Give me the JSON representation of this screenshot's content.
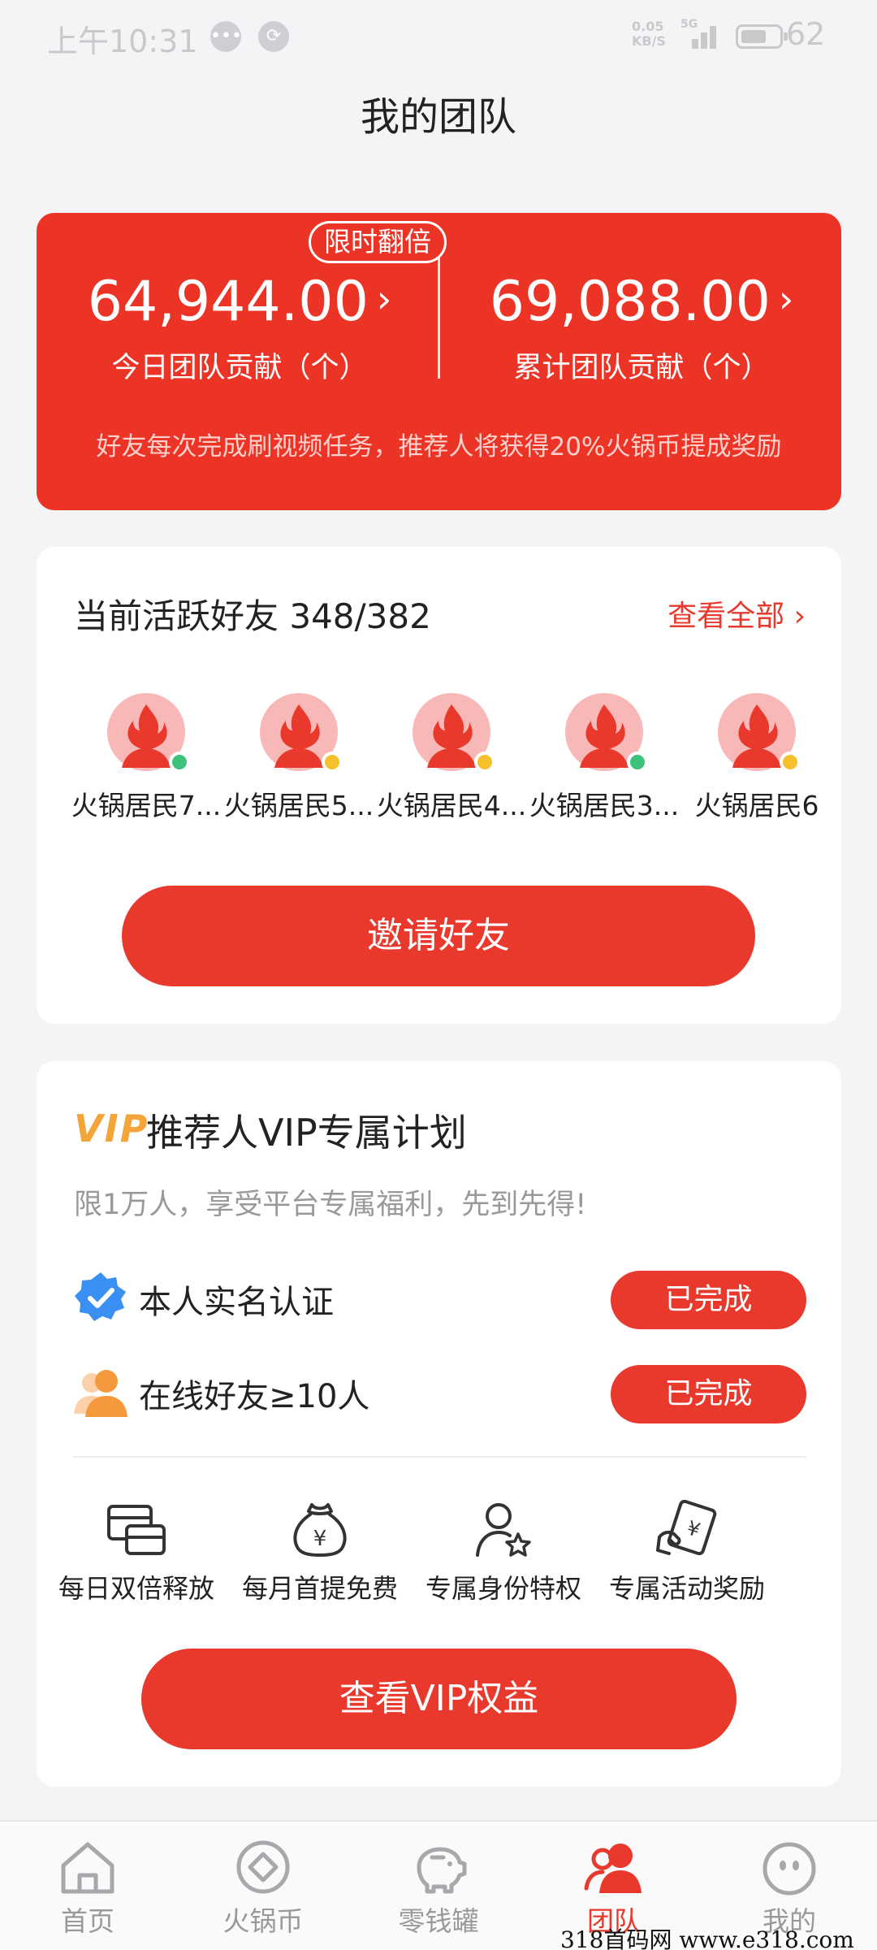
{
  "status_bar": {
    "time": "上午10:31",
    "speed_top": "0.05",
    "speed_bottom": "KB/S",
    "signal": "5G",
    "battery": "62"
  },
  "header": {
    "title": "我的团队"
  },
  "team_stats": {
    "badge": "限时翻倍",
    "today_value": "64,944.00",
    "today_label": "今日团队贡献（个）",
    "total_value": "69,088.00",
    "total_label": "累计团队贡献（个）",
    "note": "好友每次完成刷视频任务，推荐人将获得20%火锅币提成奖励",
    "chevron": "›"
  },
  "active_friends": {
    "title": "当前活跃好友 348/382",
    "view_all": "查看全部 ›",
    "friends": [
      {
        "name": "火锅居民7...",
        "status_color": "#3cc27a"
      },
      {
        "name": "火锅居民5...",
        "status_color": "#f5c02c"
      },
      {
        "name": "火锅居民4...",
        "status_color": "#f5c02c"
      },
      {
        "name": "火锅居民3...",
        "status_color": "#3cc27a"
      },
      {
        "name": "火锅居民6",
        "status_color": "#f5c02c"
      }
    ],
    "invite_button": "邀请好友"
  },
  "vip_plan": {
    "logo": "VIP",
    "title": "推荐人VIP专属计划",
    "subtitle": "限1万人，享受平台专属福利，先到先得!",
    "requirements": [
      {
        "label": "本人实名认证",
        "icon": "verified-badge-icon",
        "status": "已完成"
      },
      {
        "label": "在线好友≥10人",
        "icon": "friends-icon",
        "status": "已完成"
      }
    ],
    "benefits": [
      {
        "label": "每日双倍释放",
        "icon": "cards-icon"
      },
      {
        "label": "每月首提免费",
        "icon": "money-bag-icon"
      },
      {
        "label": "专属身份特权",
        "icon": "user-star-icon"
      },
      {
        "label": "专属活动奖励",
        "icon": "reward-ticket-icon"
      }
    ],
    "button": "查看VIP权益"
  },
  "bottom_nav": {
    "items": [
      {
        "label": "首页",
        "icon": "home-icon"
      },
      {
        "label": "火锅币",
        "icon": "coin-icon"
      },
      {
        "label": "零钱罐",
        "icon": "piggy-bank-icon"
      },
      {
        "label": "团队",
        "icon": "team-icon",
        "active": true
      },
      {
        "label": "我的",
        "icon": "profile-icon"
      }
    ]
  },
  "watermark": "318首码网 www.e318.com",
  "colors": {
    "primary_red": "#e8392c",
    "card_red": "#ec3426",
    "vip_gold": "#f3a53a",
    "background": "#f4f4f7"
  }
}
